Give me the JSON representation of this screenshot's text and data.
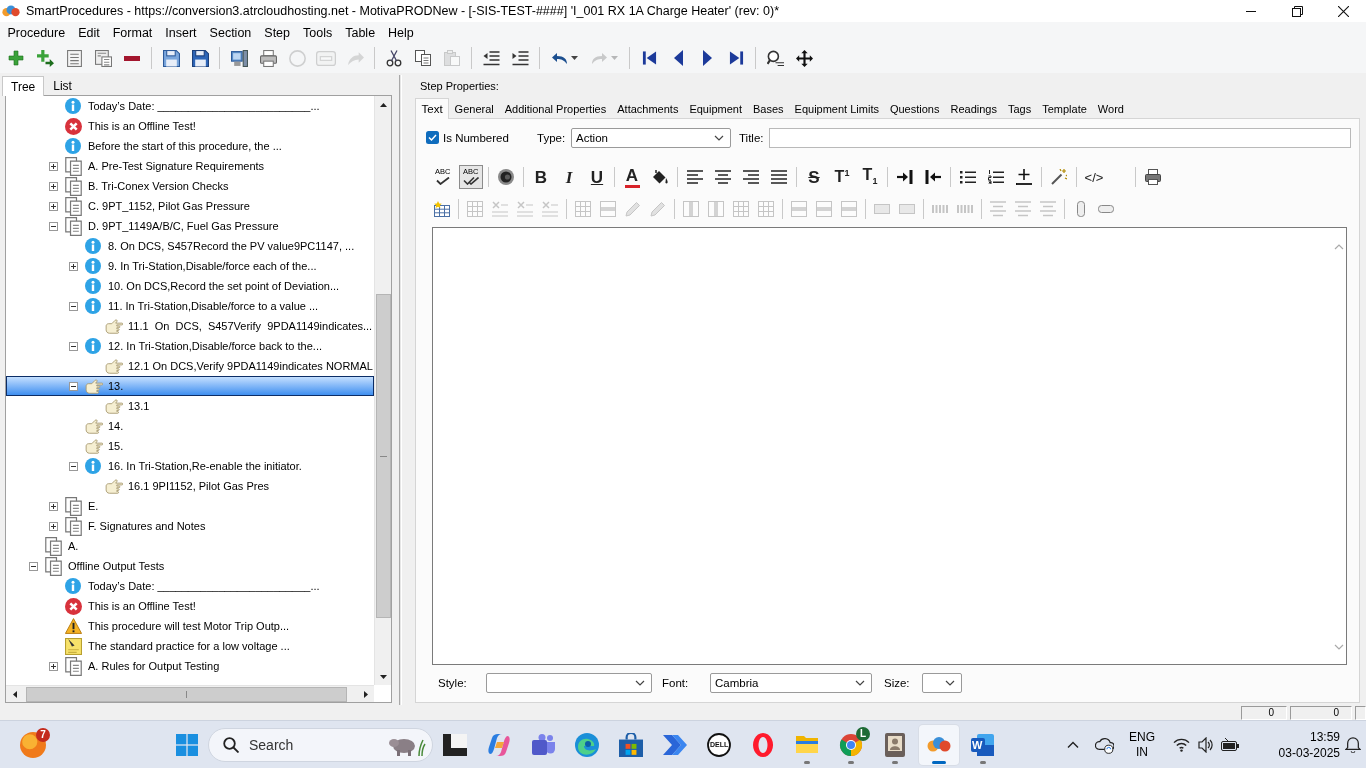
{
  "window": {
    "title": "SmartProcedures - https://conversion3.atrcloudhosting.net - MotivaPRODNew - [-SIS-TEST-####] 'I_001 RX 1A Charge Heater' (rev: 0)*"
  },
  "menu": [
    "Procedure",
    "Edit",
    "Format",
    "Insert",
    "Section",
    "Step",
    "Tools",
    "Table",
    "Help"
  ],
  "toolbar": [
    [
      {
        "kind": "add",
        "disabled": false
      },
      {
        "kind": "add-child",
        "disabled": false
      },
      {
        "kind": "outline",
        "disabled": false
      },
      {
        "kind": "properties",
        "disabled": false
      },
      {
        "kind": "remove",
        "disabled": false
      }
    ],
    [
      {
        "kind": "save-as",
        "disabled": false
      },
      {
        "kind": "save",
        "disabled": false
      }
    ],
    [
      {
        "kind": "computer",
        "disabled": false
      },
      {
        "kind": "print",
        "disabled": false
      },
      {
        "kind": "circle",
        "disabled": true
      },
      {
        "kind": "form",
        "disabled": true
      },
      {
        "kind": "arrow",
        "disabled": true
      }
    ],
    [
      {
        "kind": "cut",
        "disabled": false
      },
      {
        "kind": "copy",
        "disabled": false
      },
      {
        "kind": "paste",
        "disabled": true
      }
    ],
    [
      {
        "kind": "outdent",
        "disabled": false
      },
      {
        "kind": "indent",
        "disabled": false
      }
    ],
    [
      {
        "kind": "undo",
        "disabled": false
      },
      {
        "kind": "redo",
        "disabled": true
      }
    ],
    [
      {
        "kind": "first",
        "disabled": false
      },
      {
        "kind": "previous",
        "disabled": false
      },
      {
        "kind": "next",
        "disabled": false
      },
      {
        "kind": "last",
        "disabled": false
      }
    ],
    [
      {
        "kind": "find",
        "disabled": false
      },
      {
        "kind": "move",
        "disabled": false
      }
    ]
  ],
  "tree_tabs": [
    {
      "label": "Tree",
      "selected": true
    },
    {
      "label": "List",
      "selected": false
    }
  ],
  "tree": {
    "items": [
      {
        "children": [
          {
            "label": "Today’s Date: _________________________...",
            "kind": "info",
            "selected": false
          },
          {
            "label": "This is an Offline Test!",
            "kind": "error",
            "selected": false
          },
          {
            "label": "Before the start of this procedure, the ...",
            "kind": "info",
            "selected": false
          },
          {
            "label": "A. Pre-Test Signature Requirements",
            "kind": "section",
            "expanded": false,
            "selected": false
          },
          {
            "label": "B. Tri-Conex Version Checks",
            "kind": "section",
            "expanded": false,
            "selected": false
          },
          {
            "label": "C. 9PT_1152, Pilot Gas Pressure",
            "kind": "section",
            "expanded": false,
            "selected": false
          },
          {
            "label": "D. 9PT_1149A/B/C, Fuel Gas Pressure",
            "kind": "section",
            "expanded": true,
            "selected": false,
            "children": [
              {
                "label": "8. On DCS, S457Record the PV value9PC1147, ...",
                "kind": "info",
                "selected": false
              },
              {
                "label": "9. In Tri-Station,Disable/force each of the...",
                "kind": "info",
                "expanded": false,
                "selected": false
              },
              {
                "label": "10. On DCS,Record the set point of Deviation...",
                "kind": "info",
                "selected": false
              },
              {
                "label": "11. In Tri-Station,Disable/force to a value ...",
                "kind": "info",
                "expanded": true,
                "selected": false,
                "children": [
                  {
                    "label": "11.1  On  DCS,  S457Verify  9PDA1149indicates...",
                    "kind": "action",
                    "selected": false
                  }
                ]
              },
              {
                "label": "12. In Tri-Station,Disable/force back to the...",
                "kind": "info",
                "expanded": true,
                "selected": false,
                "children": [
                  {
                    "label": "12.1 On DCS,Verify 9PDA1149indicates NORMAL",
                    "kind": "action",
                    "selected": false
                  }
                ]
              },
              {
                "label": "13.",
                "kind": "action",
                "expanded": true,
                "selected": true,
                "children": [
                  {
                    "label": "13.1",
                    "kind": "action",
                    "selected": false
                  }
                ]
              },
              {
                "label": "14.",
                "kind": "action",
                "selected": false
              },
              {
                "label": "15.",
                "kind": "action",
                "selected": false
              },
              {
                "label": "16. In Tri-Station,Re-enable the initiator.",
                "kind": "info",
                "expanded": true,
                "selected": false,
                "children": [
                  {
                    "label": "16.1 9PI1152, Pilot Gas Pres",
                    "kind": "action",
                    "selected": false
                  }
                ]
              }
            ]
          },
          {
            "label": "E.",
            "kind": "section",
            "expanded": false,
            "selected": false
          },
          {
            "label": "F. Signatures and Notes",
            "kind": "section",
            "expanded": false,
            "selected": false
          }
        ]
      },
      {
        "label": "A.",
        "kind": "section",
        "selected": false
      },
      {
        "label": "Offline Output Tests",
        "kind": "section",
        "expanded": true,
        "selected": false,
        "children": [
          {
            "label": "Today’s Date: _________________________...",
            "kind": "info",
            "selected": false
          },
          {
            "label": "This is an Offline Test!",
            "kind": "error",
            "selected": false
          },
          {
            "label": "This procedure will test Motor Trip Outp...",
            "kind": "warning",
            "selected": false
          },
          {
            "label": "The standard practice for a low voltage ...",
            "kind": "note",
            "selected": false
          },
          {
            "label": "A. Rules for Output Testing",
            "kind": "section",
            "expanded": false,
            "selected": false
          }
        ]
      }
    ]
  },
  "step_properties": {
    "heading": "Step Properties:",
    "tabs": [
      {
        "label": "Text",
        "selected": true
      },
      {
        "label": "General",
        "selected": false
      },
      {
        "label": "Additional Properties",
        "selected": false
      },
      {
        "label": "Attachments",
        "selected": false
      },
      {
        "label": "Equipment",
        "selected": false
      },
      {
        "label": "Bases",
        "selected": false
      },
      {
        "label": "Equipment Limits",
        "selected": false
      },
      {
        "label": "Questions",
        "selected": false
      },
      {
        "label": "Readings",
        "selected": false
      },
      {
        "label": "Tags",
        "selected": false
      },
      {
        "label": "Template",
        "selected": false
      },
      {
        "label": "Word",
        "selected": false
      }
    ],
    "is_numbered": {
      "label": "Is Numbered",
      "checked": true
    },
    "type": {
      "label": "Type:",
      "value": "Action"
    },
    "title": {
      "label": "Title:"
    },
    "format_toolbar": [
      [
        {
          "kind": "spell",
          "label": "ABC"
        },
        {
          "kind": "spell-all",
          "label": "ABC",
          "pressed": true
        }
      ],
      [
        {
          "kind": "record"
        }
      ],
      [
        {
          "kind": "bold",
          "label": "B",
          "pressed": false
        },
        {
          "kind": "italic",
          "label": "I",
          "pressed": false
        },
        {
          "kind": "underline",
          "label": "U",
          "pressed": false
        }
      ],
      [
        {
          "kind": "font-color",
          "label": "A"
        },
        {
          "kind": "fill"
        }
      ],
      [
        {
          "kind": "align-left",
          "pressed": false
        },
        {
          "kind": "align-center",
          "pressed": false
        },
        {
          "kind": "align-right",
          "pressed": false
        },
        {
          "kind": "justify",
          "pressed": false
        }
      ],
      [
        {
          "kind": "strike",
          "label": "S",
          "pressed": false
        },
        {
          "kind": "superscript",
          "label": "T$^{1}$",
          "pressed": false
        },
        {
          "kind": "subscript",
          "label": "T$_{1}$",
          "pressed": false
        }
      ],
      [
        {
          "kind": "indent"
        },
        {
          "kind": "outdent"
        }
      ],
      [
        {
          "kind": "bullets",
          "pressed": false
        },
        {
          "kind": "numbering",
          "pressed": false
        },
        {
          "kind": "rule"
        }
      ],
      [
        {
          "kind": "wand"
        }
      ],
      [
        {
          "kind": "code",
          "label": "</>"
        }
      ],
      [
        {
          "kind": "print"
        }
      ]
    ],
    "table_toolbar": [
      [
        {
          "kind": "table-insert",
          "disabled": false
        }
      ],
      [
        {
          "kind": "grid",
          "disabled": true
        },
        {
          "kind": "xmark",
          "disabled": true
        },
        {
          "kind": "xmark",
          "disabled": true
        },
        {
          "kind": "xmark",
          "disabled": true
        }
      ],
      [
        {
          "kind": "grid",
          "disabled": true
        },
        {
          "kind": "row",
          "disabled": true
        },
        {
          "kind": "pencil",
          "disabled": true
        },
        {
          "kind": "pencil",
          "disabled": true
        }
      ],
      [
        {
          "kind": "column",
          "disabled": true
        },
        {
          "kind": "column",
          "disabled": true
        },
        {
          "kind": "grid",
          "disabled": true
        },
        {
          "kind": "grid",
          "disabled": true
        }
      ],
      [
        {
          "kind": "row",
          "disabled": true
        },
        {
          "kind": "row",
          "disabled": true
        },
        {
          "kind": "row",
          "disabled": true
        }
      ],
      [
        {
          "kind": "cell",
          "disabled": true
        },
        {
          "kind": "cell",
          "disabled": true
        }
      ],
      [
        {
          "kind": "dots",
          "disabled": true
        },
        {
          "kind": "dots",
          "disabled": true
        }
      ],
      [
        {
          "kind": "lines",
          "disabled": true
        },
        {
          "kind": "lines",
          "disabled": true
        },
        {
          "kind": "lines",
          "disabled": true
        }
      ],
      [
        {
          "kind": "tube",
          "disabled": false
        },
        {
          "kind": "capsule",
          "disabled": false
        }
      ]
    ],
    "style": {
      "label": "Style:"
    },
    "font": {
      "label": "Font:",
      "value": "Cambria"
    },
    "size": {
      "label": "Size:"
    }
  },
  "status_bar": [
    "0",
    "0"
  ],
  "taskbar": {
    "widget_badge": "7",
    "search": {
      "placeholder": "Search"
    },
    "apps": [
      {
        "kind": "terminal",
        "running": false,
        "active": false
      },
      {
        "kind": "copilot",
        "running": false,
        "active": false
      },
      {
        "kind": "teams",
        "running": false,
        "active": false
      },
      {
        "kind": "edge",
        "running": false,
        "active": false
      },
      {
        "kind": "store",
        "running": false,
        "active": false
      },
      {
        "kind": "automate",
        "running": false,
        "active": false
      },
      {
        "kind": "dell",
        "label": "DELL",
        "running": false,
        "active": false
      },
      {
        "kind": "opera",
        "running": false,
        "active": false
      },
      {
        "kind": "explorer",
        "running": true,
        "active": false
      },
      {
        "kind": "chrome",
        "badge": "L",
        "running": true,
        "active": false
      },
      {
        "kind": "contacts",
        "running": true,
        "active": false
      },
      {
        "kind": "smartprocedures",
        "running": true,
        "active": true
      },
      {
        "kind": "word",
        "label": "W",
        "running": true,
        "active": false
      }
    ],
    "tray": {
      "language": "ENG",
      "region": "IN",
      "time": "13:59",
      "date": "03-03-2025"
    }
  }
}
